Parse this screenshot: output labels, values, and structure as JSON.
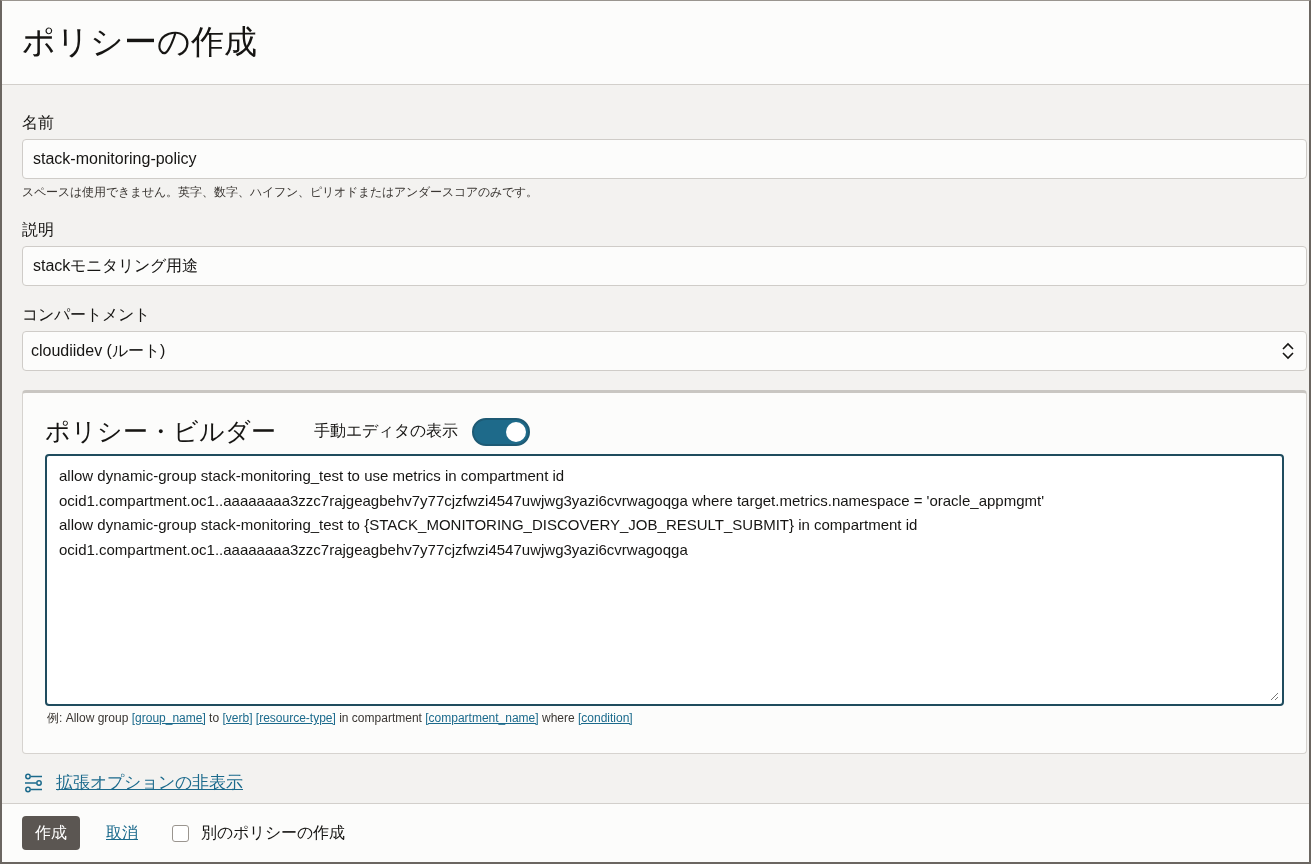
{
  "page": {
    "title": "ポリシーの作成"
  },
  "fields": [
    {
      "kind": "text",
      "label": "名前",
      "value": "stack-monitoring-policy",
      "help": "スペースは使用できません。英字、数字、ハイフン、ピリオドまたはアンダースコアのみです。"
    },
    {
      "kind": "text",
      "label": "説明",
      "value": "stackモニタリング用途"
    },
    {
      "kind": "select",
      "label": "コンパートメント",
      "value": "cloudiidev (ルート)"
    }
  ],
  "policy_builder": {
    "title": "ポリシー・ビルダー",
    "toggle": {
      "label": "手動エディタの表示",
      "on": true
    },
    "editor_lines": [
      "allow dynamic-group stack-monitoring_test to use metrics in compartment id",
      "ocid1.compartment.oc1..aaaaaaaa3zzc7rajgeagbehv7y77cjzfwzi4547uwjwg3yazi6cvrwagoqga where target.metrics.namespace = 'oracle_appmgmt'",
      "allow dynamic-group stack-monitoring_test to {STACK_MONITORING_DISCOVERY_JOB_RESULT_SUBMIT} in compartment id",
      "ocid1.compartment.oc1..aaaaaaaa3zzc7rajgeagbehv7y77cjzfwzi4547uwjwg3yazi6cvrwagoqga"
    ],
    "example": [
      {
        "kind": "text",
        "text": "例: Allow group "
      },
      {
        "kind": "link",
        "text": "[group_name]"
      },
      {
        "kind": "text",
        "text": " to "
      },
      {
        "kind": "link",
        "text": "[verb]"
      },
      {
        "kind": "link",
        "text": "[resource-type]"
      },
      {
        "kind": "text",
        "text": " in compartment "
      },
      {
        "kind": "link",
        "text": "[compartment_name]"
      },
      {
        "kind": "text",
        "text": " where "
      },
      {
        "kind": "link",
        "text": "[condition]"
      }
    ]
  },
  "advanced_link": "拡張オプションの非表示",
  "footer": {
    "create_button": "作成",
    "cancel_link": "取消",
    "another_checkbox": {
      "label": "別のポリシーの作成",
      "checked": false
    }
  }
}
